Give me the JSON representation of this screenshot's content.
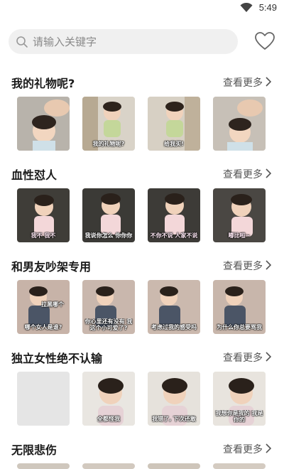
{
  "status": {
    "time": "5:49",
    "wifi_icon": "wifi-icon"
  },
  "search": {
    "placeholder": "请输入关键字",
    "icon": "search-icon"
  },
  "favorite_icon": "heart-icon",
  "more_label": "查看更多",
  "sections": [
    {
      "title": "我的礼物呢?",
      "captions": [
        "",
        "我的礼物呢?",
        "给我买!",
        ""
      ]
    },
    {
      "title": "血性怼人",
      "captions": [
        "我不 我不",
        "我说你怎么 你你你",
        "不你不说 人家不说",
        "嘟比啦~"
      ]
    },
    {
      "title": "和男友吵架专用",
      "captions": [
        "拉黑哪个",
        "哪个女人是谁?",
        "你心里还有没有 我这个小可爱了?",
        "为什么你总要骂我"
      ]
    },
    {
      "title": "独立女性绝不认输",
      "captions": [
        "",
        "全都怪我",
        "我错了, 下次还敢",
        "我想你是我的 我是你的"
      ]
    },
    {
      "title": "无限悲伤",
      "captions": []
    }
  ]
}
